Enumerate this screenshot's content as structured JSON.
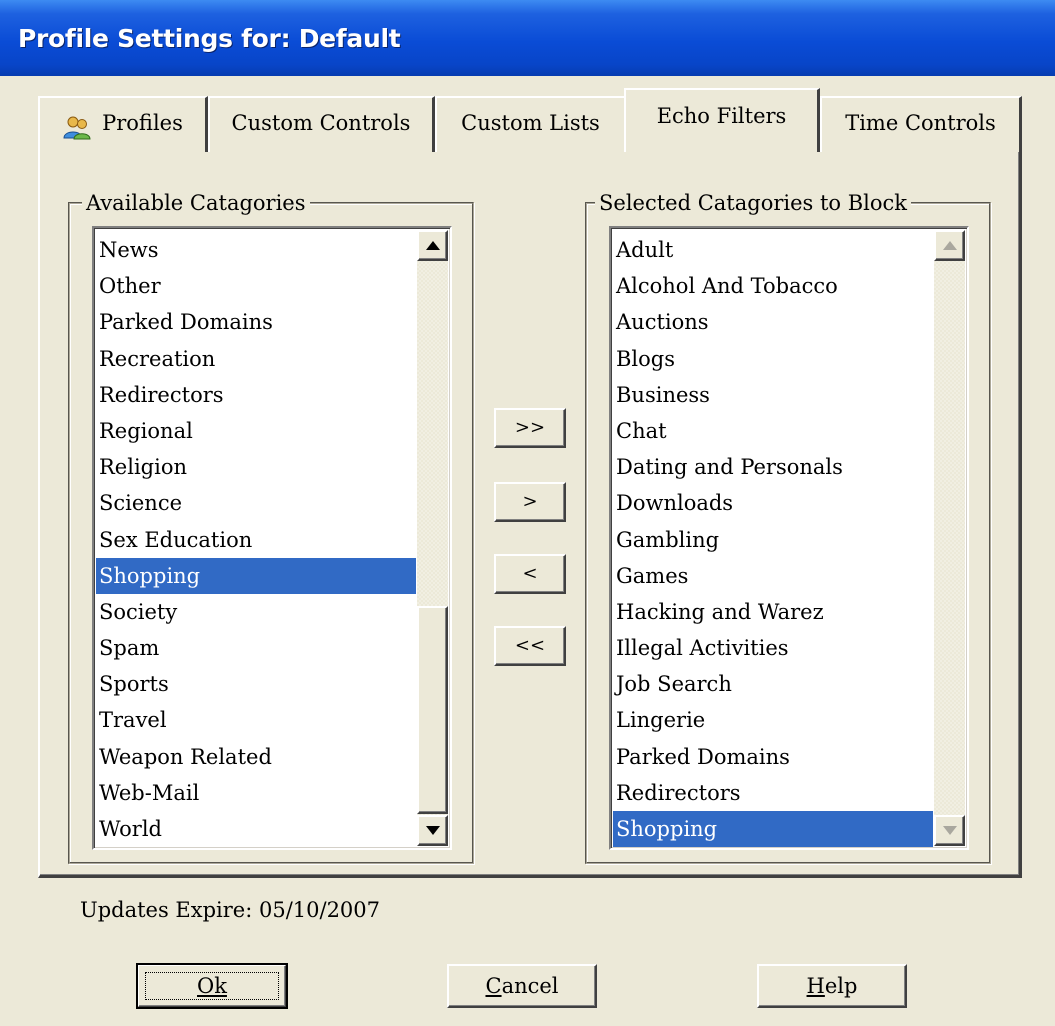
{
  "window": {
    "title": "Profile Settings for: Default"
  },
  "tabs": [
    {
      "label": "Profiles",
      "icon": "users-icon"
    },
    {
      "label": "Custom Controls"
    },
    {
      "label": "Custom Lists"
    },
    {
      "label": "Echo Filters",
      "active": true
    },
    {
      "label": "Time Controls"
    }
  ],
  "available": {
    "label": "Available Catagories",
    "items": [
      "News",
      "Other",
      "Parked Domains",
      "Recreation",
      "Redirectors",
      "Regional",
      "Religion",
      "Science",
      "Sex Education",
      "Shopping",
      "Society",
      "Spam",
      "Sports",
      "Travel",
      "Weapon Related",
      "Web-Mail",
      "World"
    ],
    "selected": "Shopping"
  },
  "blocked": {
    "label": "Selected Catagories to Block",
    "items": [
      "Adult",
      "Alcohol And Tobacco",
      "Auctions",
      "Blogs",
      "Business",
      "Chat",
      "Dating and Personals",
      "Downloads",
      "Gambling",
      "Games",
      "Hacking and Warez",
      "Illegal Activities",
      "Job Search",
      "Lingerie",
      "Parked Domains",
      "Redirectors",
      "Shopping"
    ],
    "selected": "Shopping"
  },
  "transfer": {
    "add_all": ">>",
    "add": ">",
    "remove": "<",
    "remove_all": "<<"
  },
  "status": {
    "updates_expire": "Updates Expire: 05/10/2007"
  },
  "footer": {
    "ok": "Ok",
    "cancel": "Cancel",
    "help": "Help"
  },
  "colors": {
    "title_bar": "#0A4CD6",
    "selection": "#316AC5",
    "face": "#ECE9D8"
  }
}
